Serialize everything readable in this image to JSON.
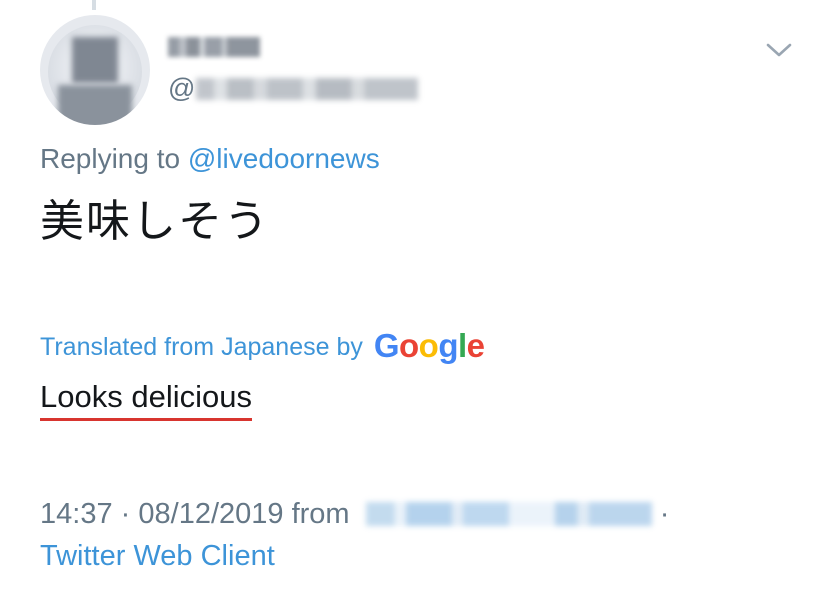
{
  "tweet": {
    "author": {
      "handle_prefix": "@"
    },
    "replying_prefix": "Replying to ",
    "replying_to": "@livedoornews",
    "text": "美味しそう",
    "translation": {
      "label": "Translated from Japanese by",
      "provider_letters": [
        "G",
        "o",
        "o",
        "g",
        "l",
        "e"
      ],
      "text": "Looks delicious"
    },
    "meta": {
      "time": "14:37",
      "separator": "·",
      "date": "08/12/2019",
      "from_label": "from",
      "trailing_separator": "·",
      "client": "Twitter Web Client"
    }
  },
  "colors": {
    "link": "#3d94d8",
    "muted": "#657786",
    "text": "#14171a",
    "underline": "#d8352f"
  },
  "icons": {
    "menu": "chevron-down-icon"
  }
}
